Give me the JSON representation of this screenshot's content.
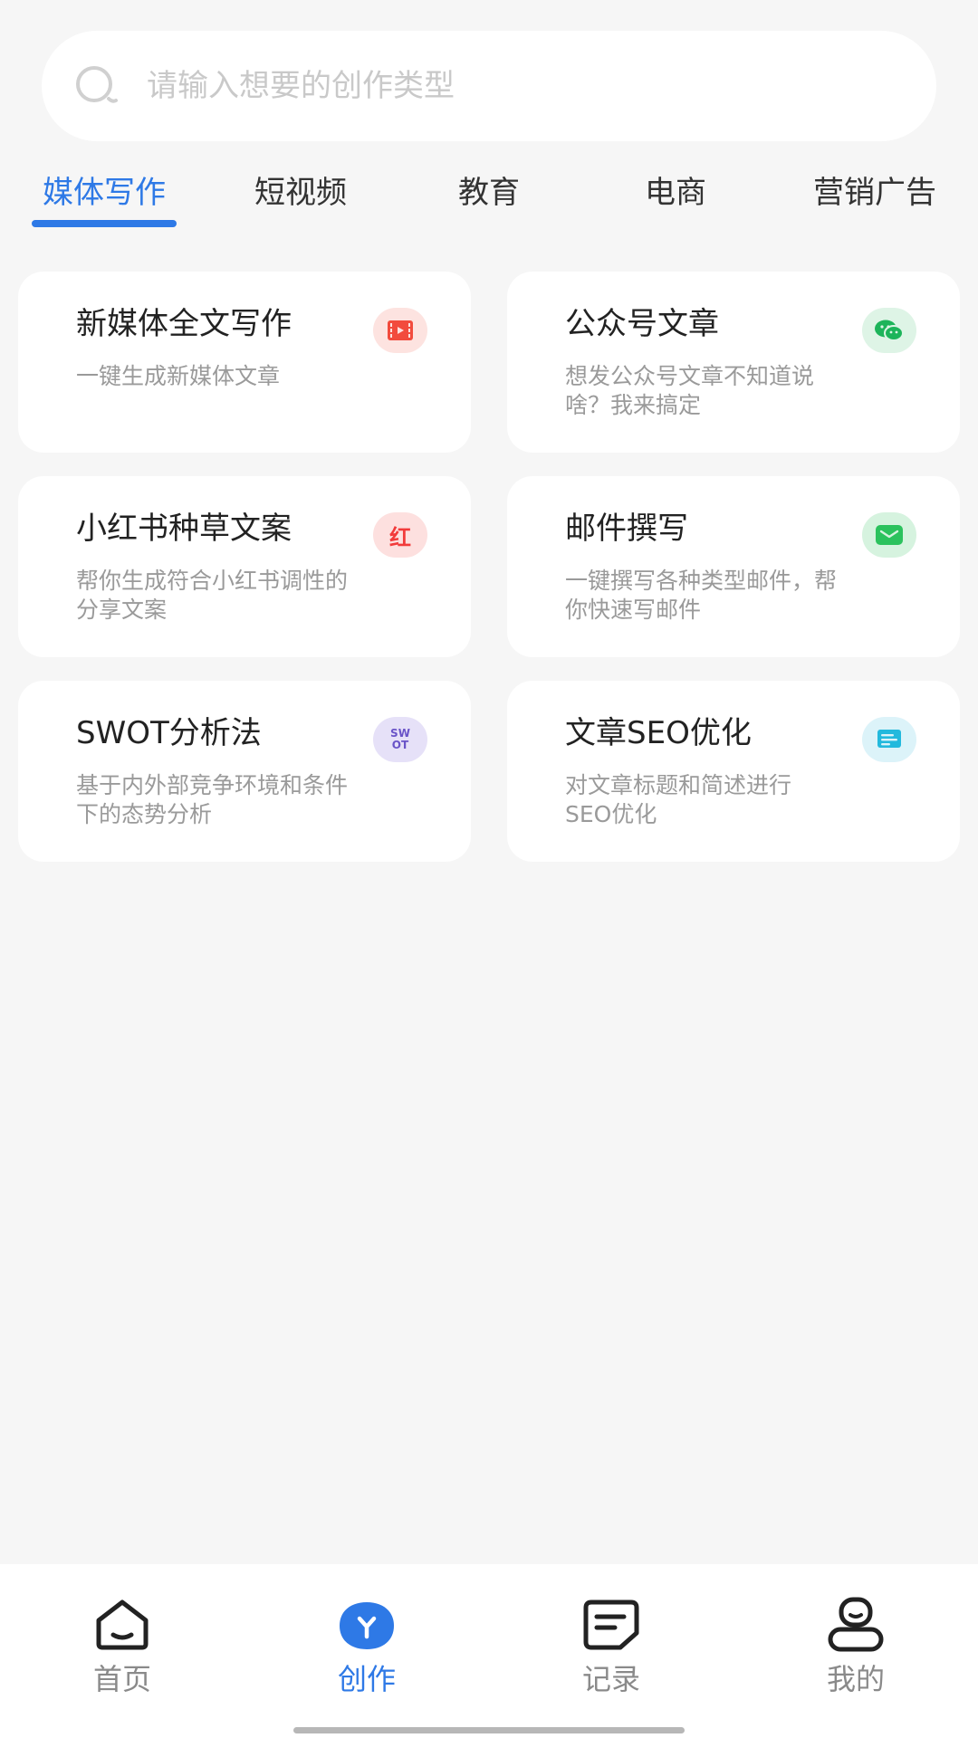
{
  "search": {
    "placeholder": "请输入想要的创作类型",
    "value": ""
  },
  "tabs": [
    {
      "label": "媒体写作",
      "active": true
    },
    {
      "label": "短视频",
      "active": false
    },
    {
      "label": "教育",
      "active": false
    },
    {
      "label": "电商",
      "active": false
    },
    {
      "label": "营销广告",
      "active": false
    }
  ],
  "cards": [
    {
      "title": "新媒体全文写作",
      "desc": "一键生成新媒体文章",
      "icon": "video-clapper-icon",
      "color": "#f24b3d",
      "bg": "#fde3e0"
    },
    {
      "title": "公众号文章",
      "desc": "想发公众号文章不知道说啥？我来搞定",
      "icon": "wechat-icon",
      "color": "#1db45a",
      "bg": "#def4e6"
    },
    {
      "title": "小红书种草文案",
      "desc": "帮你生成符合小红书调性的分享文案",
      "icon": "xiaohongshu-icon",
      "icon_text": "红",
      "color": "#f23b3b",
      "bg": "#fde0df"
    },
    {
      "title": "邮件撰写",
      "desc": "一键撰写各种类型邮件，帮你快速写邮件",
      "icon": "mail-icon",
      "color": "#2bc25d",
      "bg": "#d6f3df"
    },
    {
      "title": "SWOT分析法",
      "desc": "基于内外部竞争环境和条件下的态势分析",
      "icon": "swot-icon",
      "icon_text_1": "SW",
      "icon_text_2": "OT",
      "color": "#6a54c8",
      "bg": "#e6e1f8"
    },
    {
      "title": "文章SEO优化",
      "desc": "对文章标题和简述进行SEO优化",
      "icon": "document-icon",
      "color": "#23b9dd",
      "bg": "#dcf3f9"
    }
  ],
  "bottom_nav": [
    {
      "label": "首页",
      "icon": "home-icon",
      "active": false
    },
    {
      "label": "创作",
      "icon": "create-icon",
      "active": true
    },
    {
      "label": "记录",
      "icon": "records-icon",
      "active": false
    },
    {
      "label": "我的",
      "icon": "profile-icon",
      "active": false
    }
  ],
  "colors": {
    "accent": "#2e79e6",
    "background": "#f6f6f6"
  }
}
